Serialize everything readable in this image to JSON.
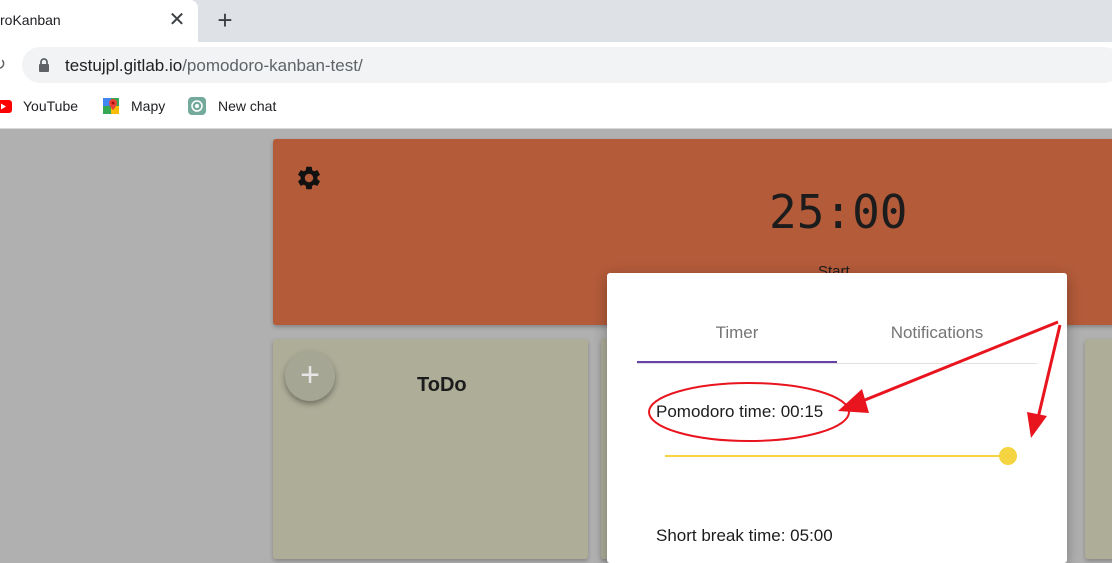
{
  "browser": {
    "tab_title": "roKanban",
    "tab_close": "✕",
    "new_tab": "+",
    "reload": "↻",
    "url_host": "testujpl.gitlab.io",
    "url_path": "/pomodoro-kanban-test/",
    "bookmarks": [
      {
        "label": "YouTube",
        "icon": "youtube-icon"
      },
      {
        "label": "Mapy",
        "icon": "maps-icon"
      },
      {
        "label": "New chat",
        "icon": "chatgpt-icon"
      }
    ]
  },
  "app": {
    "timer": "25:00",
    "start_label": "Start",
    "add_label": "+",
    "column_title": "ToDo"
  },
  "settings_dialog": {
    "tabs": [
      "Timer",
      "Notifications"
    ],
    "active_tab": "Timer",
    "pomodoro_label": "Pomodoro time: 00:15",
    "short_break_label": "Short break time: 05:00",
    "slider_value_fraction": 1.0
  },
  "colors": {
    "timer_card": "#b45b3a",
    "column": "#adad98",
    "accent": "#6741a8",
    "slider": "#f5d442",
    "annotation": "#e8141e"
  }
}
